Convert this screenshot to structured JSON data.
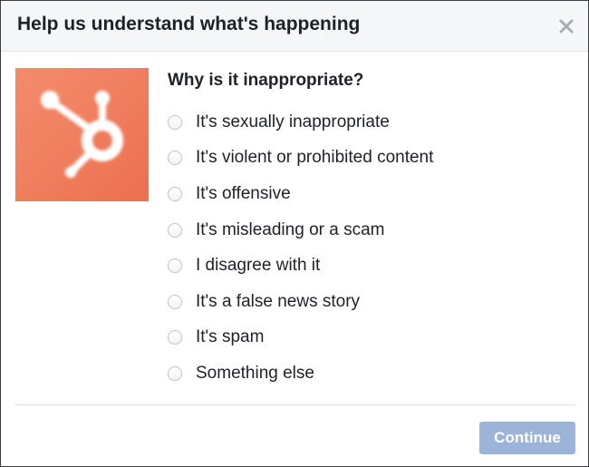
{
  "dialog": {
    "title": "Help us understand what's happening",
    "close_icon": "close-icon",
    "thumbnail_icon": "hubspot-sprocket-logo",
    "question": "Why is it inappropriate?",
    "options": [
      {
        "label": "It's sexually inappropriate",
        "selected": false
      },
      {
        "label": "It's violent or prohibited content",
        "selected": false
      },
      {
        "label": "It's offensive",
        "selected": false
      },
      {
        "label": "It's misleading or a scam",
        "selected": false
      },
      {
        "label": "I disagree with it",
        "selected": false
      },
      {
        "label": "It's a false news story",
        "selected": false
      },
      {
        "label": "It's spam",
        "selected": false
      },
      {
        "label": "Something else",
        "selected": false
      }
    ],
    "continue_label": "Continue",
    "continue_disabled": true
  },
  "colors": {
    "header_bg": "#f5f6f7",
    "text": "#1d2129",
    "thumbnail_bg": "#f07e5f",
    "button_disabled": "#9cb4d8",
    "divider": "#dddfe2"
  }
}
